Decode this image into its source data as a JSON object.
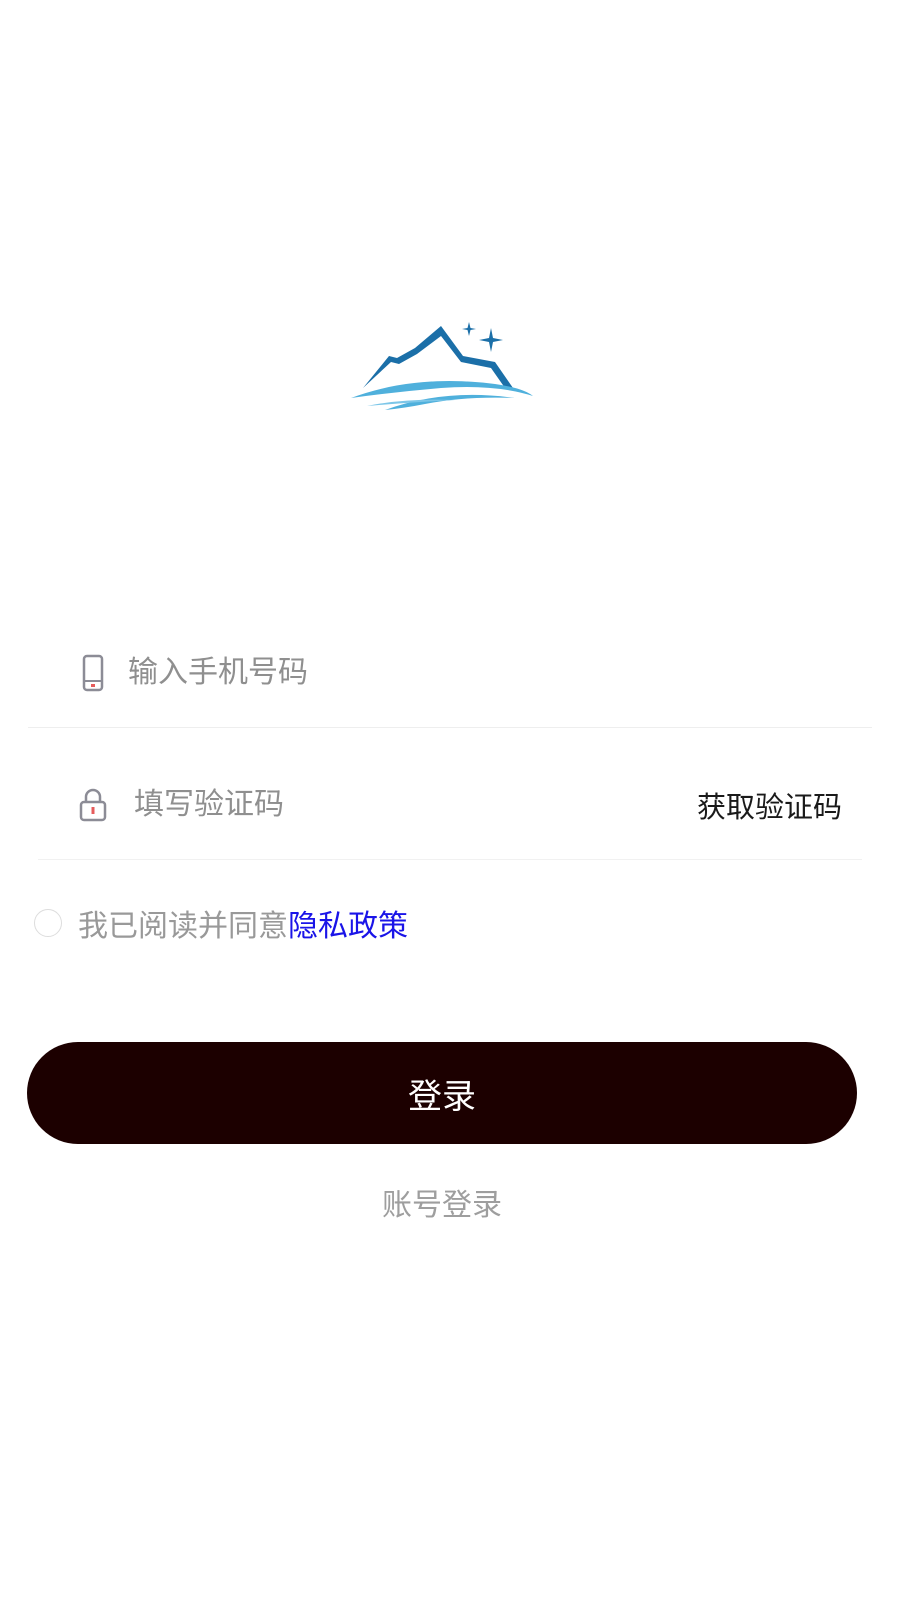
{
  "logo": {
    "icon": "mountain-stars-logo",
    "colors": {
      "mountain": "#1b6fa8",
      "wave": "#4fb0dc",
      "star": "#1b6fa8"
    }
  },
  "phone_field": {
    "icon": "phone-icon",
    "placeholder": "输入手机号码",
    "value": ""
  },
  "code_field": {
    "icon": "lock-icon",
    "placeholder": "填写验证码",
    "value": "",
    "get_code_label": "获取验证码"
  },
  "agreement": {
    "checked": false,
    "text": "我已阅读并同意",
    "link_label": "隐私政策",
    "link_color": "#1a14e8"
  },
  "login_button": {
    "label": "登录",
    "color": "#1c0000"
  },
  "account_login": {
    "label": "账号登录"
  }
}
